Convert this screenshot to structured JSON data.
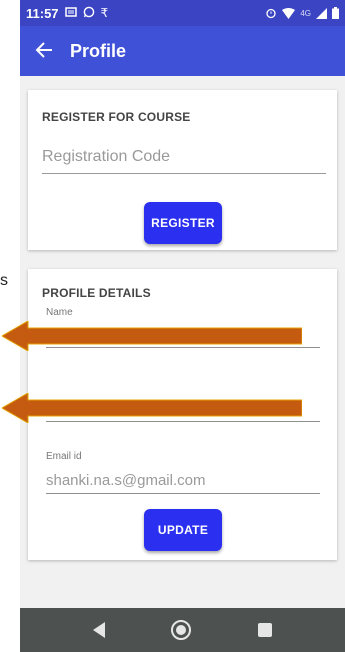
{
  "status_bar": {
    "time": "11:57",
    "left_icons": [
      "notes-icon",
      "whatsapp-icon",
      "rupee-icon"
    ],
    "right_icons": [
      "alarm-icon",
      "wifi-icon",
      "signal-4g-icon",
      "battery-icon"
    ],
    "network": "4G"
  },
  "app_bar": {
    "title": "Profile",
    "color": "#3f51d6"
  },
  "register_card": {
    "heading": "REGISTER FOR COURSE",
    "input_placeholder": "Registration Code",
    "button_label": "REGISTER"
  },
  "profile_card": {
    "heading": "PROFILE DETAILS",
    "name_label": "Name",
    "email_label": "Email id",
    "email_value": "shanki.na.s@gmail.com",
    "button_label": "UPDATE"
  },
  "stray_text": "s",
  "accent": "#2b2ff0",
  "annotation_arrow_color": "#c55a11"
}
